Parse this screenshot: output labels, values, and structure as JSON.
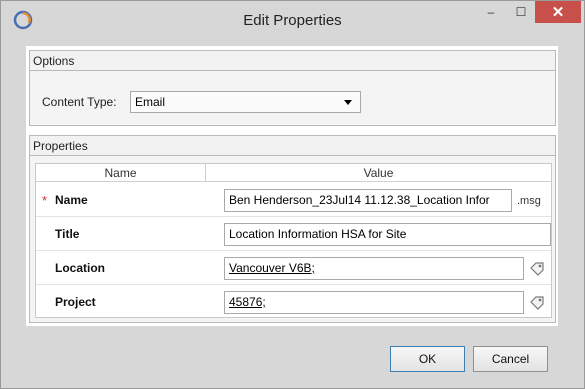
{
  "window": {
    "title": "Edit Properties",
    "minimize_glyph": "–",
    "maximize_glyph": "☐",
    "close_glyph": "✕"
  },
  "options": {
    "header": "Options",
    "content_type_label": "Content Type:",
    "content_type_value": "Email"
  },
  "properties": {
    "header": "Properties",
    "columns": {
      "name": "Name",
      "value": "Value"
    },
    "rows": [
      {
        "label": "Name",
        "required": true,
        "value": "Ben Henderson_23Jul14 11.12.38_Location Infor",
        "suffix": ".msg"
      },
      {
        "label": "Title",
        "required": false,
        "value": "Location Information HSA for Site"
      },
      {
        "label": "Location",
        "required": false,
        "value": "Vancouver V6B;",
        "lookup_icon": "tag-lookup-icon"
      },
      {
        "label": "Project",
        "required": false,
        "value": "45876;",
        "lookup_icon": "tag-lookup-icon"
      }
    ],
    "required_marker": "*"
  },
  "buttons": {
    "ok": "OK",
    "cancel": "Cancel"
  },
  "colors": {
    "close_button": "#c7514a",
    "required": "#d03030",
    "window_bg": "#d7d7d7"
  }
}
